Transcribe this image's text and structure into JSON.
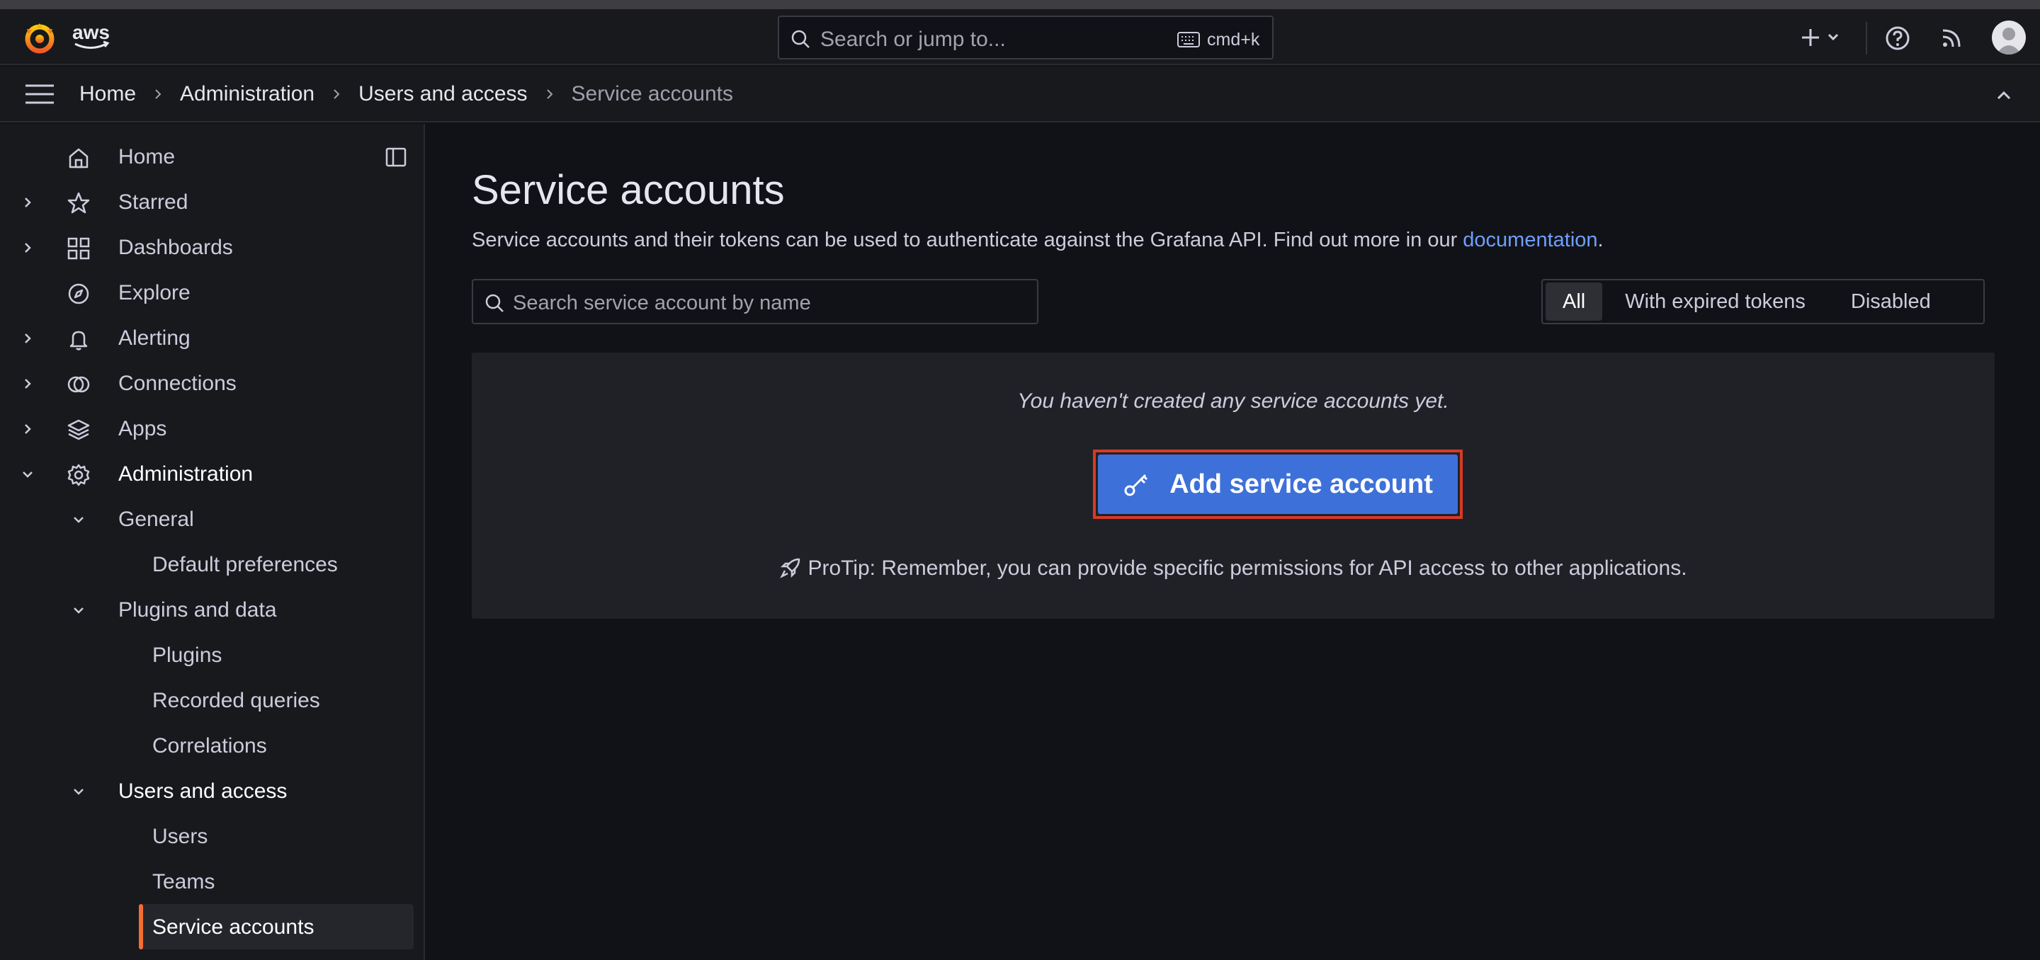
{
  "topbar": {
    "brand": "aws",
    "search_placeholder": "Search or jump to...",
    "search_shortcut": "cmd+k"
  },
  "breadcrumb": [
    "Home",
    "Administration",
    "Users and access",
    "Service accounts"
  ],
  "sidebar": {
    "items": [
      {
        "label": "Home",
        "icon": "home-icon"
      },
      {
        "label": "Starred",
        "icon": "star-icon"
      },
      {
        "label": "Dashboards",
        "icon": "apps-grid-icon"
      },
      {
        "label": "Explore",
        "icon": "compass-icon"
      },
      {
        "label": "Alerting",
        "icon": "bell-icon"
      },
      {
        "label": "Connections",
        "icon": "link-circles-icon"
      },
      {
        "label": "Apps",
        "icon": "layers-icon"
      },
      {
        "label": "Administration",
        "icon": "cog-icon"
      },
      {
        "label": "General"
      },
      {
        "label": "Default preferences"
      },
      {
        "label": "Plugins and data"
      },
      {
        "label": "Plugins"
      },
      {
        "label": "Recorded queries"
      },
      {
        "label": "Correlations"
      },
      {
        "label": "Users and access"
      },
      {
        "label": "Users"
      },
      {
        "label": "Teams"
      },
      {
        "label": "Service accounts"
      }
    ]
  },
  "main": {
    "title": "Service accounts",
    "description": "Service accounts and their tokens can be used to authenticate against the Grafana API. Find out more in our ",
    "doc_link": "documentation",
    "doc_suffix": ".",
    "search_placeholder": "Search service account by name",
    "filters": [
      "All",
      "With expired tokens",
      "Disabled"
    ],
    "selected_filter": "All",
    "empty_message": "You haven't created any service accounts yet.",
    "add_button": "Add service account",
    "protip": "ProTip: Remember, you can provide specific permissions for API access to other applications."
  },
  "colors": {
    "accent": "#f46e32",
    "primary_button": "#3d71d9",
    "highlight_border": "#d73a24",
    "link": "#6e9fff"
  }
}
